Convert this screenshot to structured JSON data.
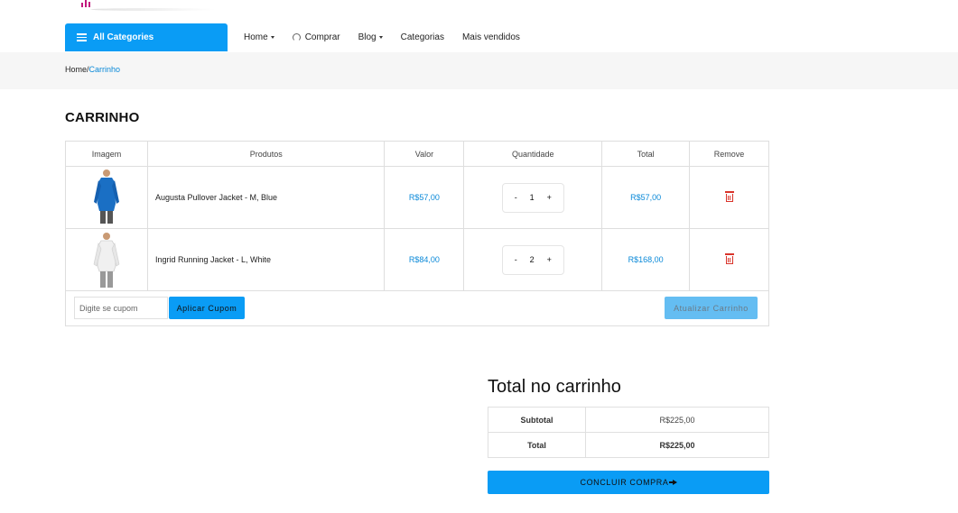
{
  "header": {
    "all_categories": "All Categories",
    "nav": [
      {
        "label": "Home",
        "dropdown": true,
        "icon": ""
      },
      {
        "label": "Comprar",
        "dropdown": false,
        "icon": "headset-icon"
      },
      {
        "label": "Blog",
        "dropdown": true,
        "icon": ""
      },
      {
        "label": "Categorias",
        "dropdown": false,
        "icon": ""
      },
      {
        "label": "Mais vendidos",
        "dropdown": false,
        "icon": ""
      }
    ]
  },
  "breadcrumb": {
    "home": "Home",
    "separator": "/",
    "current": "Carrinho"
  },
  "page_title": "CARRINHO",
  "cart": {
    "columns": [
      "Imagem",
      "Produtos",
      "Valor",
      "Quantidade",
      "Total",
      "Remove"
    ],
    "items": [
      {
        "name": "Augusta Pullover Jacket - M, Blue",
        "price": "R$57,00",
        "qty": "1",
        "total": "R$57,00",
        "image_color": "#1a6fc4"
      },
      {
        "name": "Ingrid Running Jacket - L, White",
        "price": "R$84,00",
        "qty": "2",
        "total": "R$168,00",
        "image_color": "#f2f2f2"
      }
    ],
    "minus": "-",
    "plus": "+",
    "coupon_placeholder": "Digite se cupom",
    "apply_coupon": "Aplicar Cupom",
    "update_cart": "Atualizar Carrinho"
  },
  "totals": {
    "title": "Total no carrinho",
    "subtotal_label": "Subtotal",
    "subtotal_value": "R$225,00",
    "total_label": "Total",
    "total_value": "R$225,00",
    "checkout": "CONCLUIR COMPRA"
  },
  "colors": {
    "accent": "#0a9cf5",
    "price": "#0a89d8",
    "danger": "#d9342b"
  }
}
